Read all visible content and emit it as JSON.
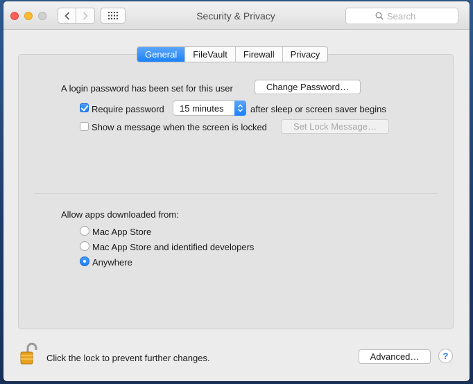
{
  "window": {
    "title": "Security & Privacy"
  },
  "toolbar": {
    "back_icon": "chevron-left-icon",
    "forward_icon": "chevron-right-icon",
    "show_all_icon": "grid-icon",
    "search_placeholder": "Search"
  },
  "tabs": [
    {
      "label": "General",
      "active": true
    },
    {
      "label": "FileVault",
      "active": false
    },
    {
      "label": "Firewall",
      "active": false
    },
    {
      "label": "Privacy",
      "active": false
    }
  ],
  "general": {
    "login_password_text": "A login password has been set for this user",
    "change_password_label": "Change Password…",
    "require_password": {
      "checked": true,
      "label": "Require password",
      "select_value": "15 minutes",
      "suffix": "after sleep or screen saver begins"
    },
    "show_message": {
      "checked": false,
      "label": "Show a message when the screen is locked",
      "button_label": "Set Lock Message…"
    },
    "allow_apps": {
      "heading": "Allow apps downloaded from:",
      "options": [
        {
          "label": "Mac App Store",
          "selected": false
        },
        {
          "label": "Mac App Store and identified developers",
          "selected": false
        },
        {
          "label": "Anywhere",
          "selected": true
        }
      ]
    }
  },
  "footer": {
    "lock_text": "Click the lock to prevent further changes.",
    "advanced_label": "Advanced…",
    "help_label": "?"
  },
  "colors": {
    "accent": "#1a82fb",
    "close": "#fc5f57",
    "minimize": "#fdbc2e",
    "lock": "#e9a21e"
  }
}
